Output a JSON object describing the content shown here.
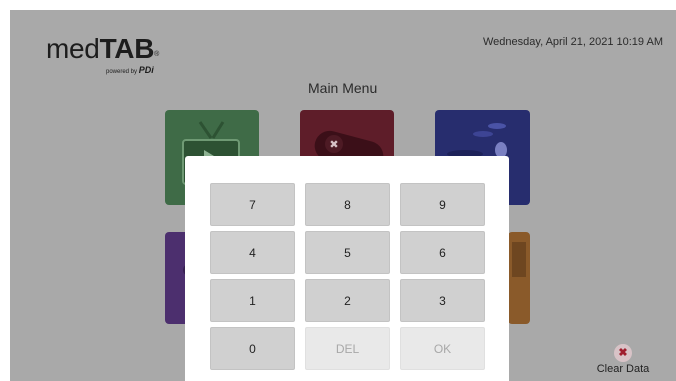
{
  "app": {
    "logo_prefix": "med",
    "logo_bold": "TAB",
    "logo_reg": "®",
    "powered_by": "powered by",
    "powered_brand": "PDi",
    "datetime": "Wednesday, April 21, 2021 10:19 AM"
  },
  "menu": {
    "title": "Main Menu",
    "tiles": [
      {
        "icon": "tv-icon",
        "color": "#3f6b47"
      },
      {
        "icon": "game-controller-icon",
        "color": "#5e1d29"
      },
      {
        "icon": "swim-icon",
        "color": "#272d6e"
      },
      {
        "icon": "unknown-icon",
        "color": "#4c2f6e"
      },
      {
        "icon": "unknown-icon",
        "color": "#8a5a2a"
      }
    ]
  },
  "keypad": {
    "keys": [
      "7",
      "8",
      "9",
      "4",
      "5",
      "6",
      "1",
      "2",
      "3",
      "0",
      "DEL",
      "OK"
    ],
    "disabled": [
      "DEL",
      "OK"
    ]
  },
  "footer": {
    "clear_data_label": "Clear Data",
    "clear_data_icon": "close-circle-icon"
  }
}
